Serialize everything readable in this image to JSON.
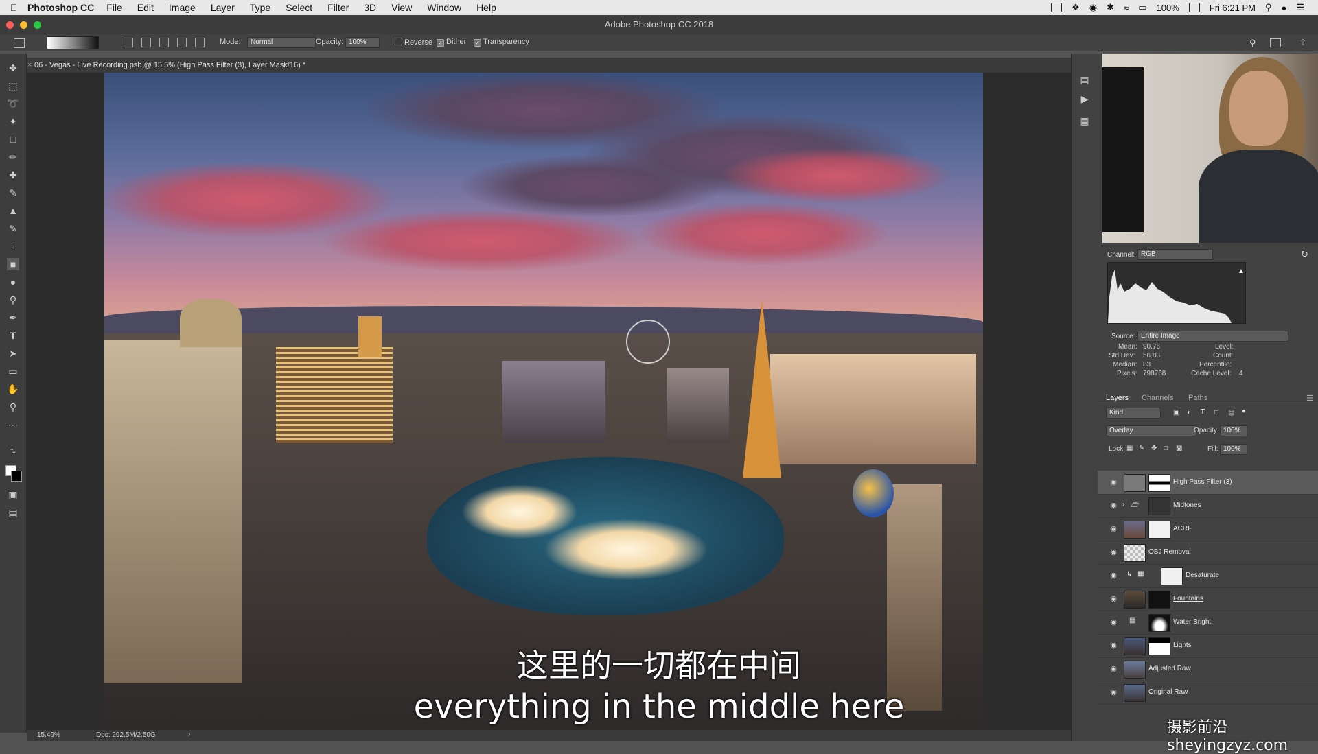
{
  "menubar": {
    "app_name": "Photoshop CC",
    "items": [
      "File",
      "Edit",
      "Image",
      "Layer",
      "Type",
      "Select",
      "Filter",
      "3D",
      "View",
      "Window",
      "Help"
    ],
    "battery": "100%",
    "clock": "Fri 6:21 PM"
  },
  "window": {
    "title": "Adobe Photoshop CC 2018"
  },
  "options": {
    "mode_label": "Mode:",
    "mode_value": "Normal",
    "opacity_label": "Opacity:",
    "opacity_value": "100%",
    "reverse_label": "Reverse",
    "dither_label": "Dither",
    "transparency_label": "Transparency"
  },
  "document": {
    "tab_title": "06 - Vegas - Live Recording.psb @ 15.5% (High Pass Filter (3), Layer Mask/16) *",
    "zoom": "15.49%",
    "doc_size": "Doc: 292.5M/2.50G"
  },
  "subtitles": {
    "cn": "这里的一切都在中间",
    "en": "everything in the middle here"
  },
  "watermark": "摄影前沿 sheyingzyz.com",
  "histogram": {
    "channel_label": "Channel:",
    "channel_value": "RGB",
    "source_label": "Source:",
    "source_value": "Entire Image",
    "mean_label": "Mean:",
    "mean_value": "90.76",
    "stddev_label": "Std Dev:",
    "stddev_value": "56.83",
    "median_label": "Median:",
    "median_value": "83",
    "pixels_label": "Pixels:",
    "pixels_value": "798768",
    "level_label": "Level:",
    "count_label": "Count:",
    "percentile_label": "Percentile:",
    "cache_label": "Cache Level:",
    "cache_value": "4"
  },
  "layers_panel": {
    "tabs": [
      "Layers",
      "Channels",
      "Paths"
    ],
    "kind_label": "Kind",
    "blend_mode": "Overlay",
    "opacity_label": "Opacity:",
    "opacity_value": "100%",
    "lock_label": "Lock:",
    "fill_label": "Fill:",
    "fill_value": "100%",
    "layers": [
      {
        "name": "High Pass Filter (3)"
      },
      {
        "name": "Midtones"
      },
      {
        "name": "ACRF"
      },
      {
        "name": "OBJ Removal"
      },
      {
        "name": "Desaturate"
      },
      {
        "name": "Fountains"
      },
      {
        "name": "Water Bright"
      },
      {
        "name": "Lights"
      },
      {
        "name": "Adjusted Raw"
      },
      {
        "name": "Original Raw"
      }
    ]
  }
}
